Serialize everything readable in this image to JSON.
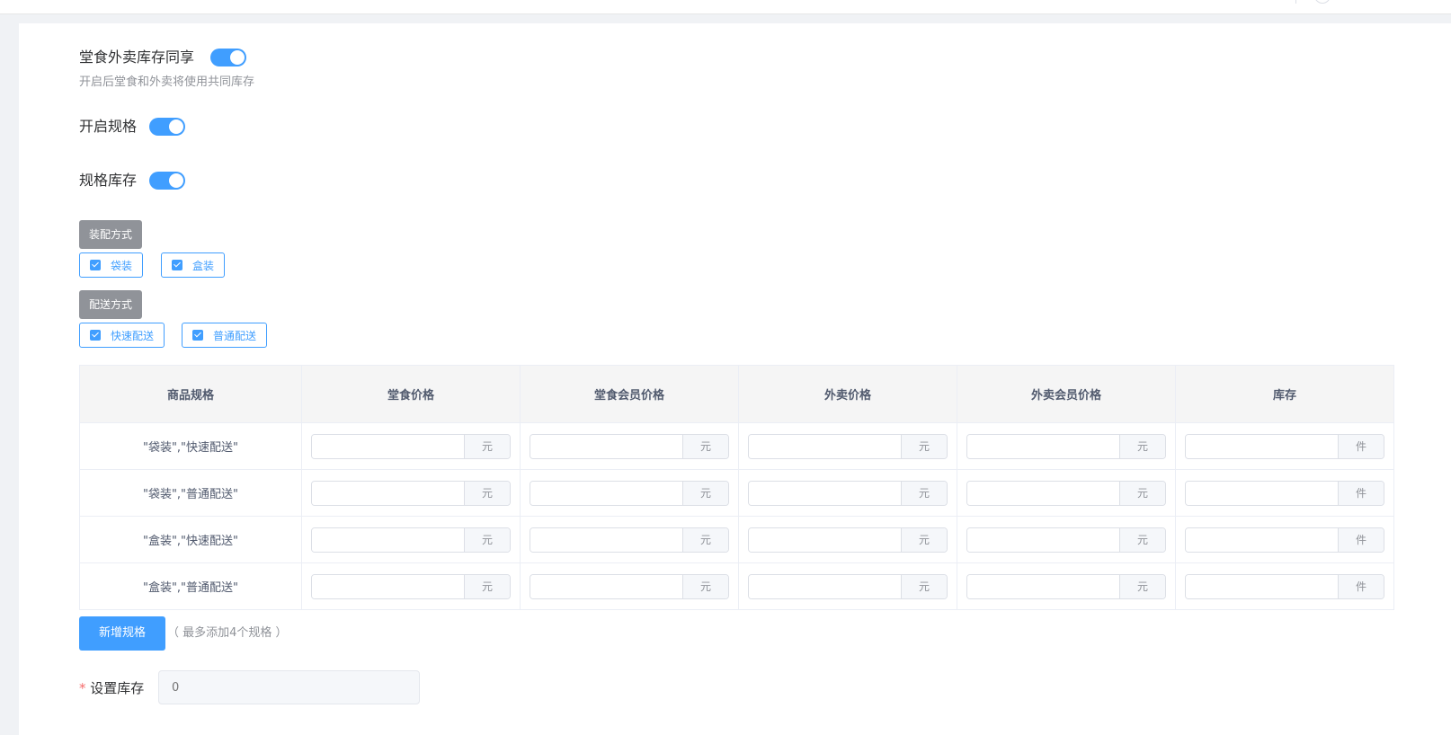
{
  "settings": {
    "shared_stock_label": "堂食外卖库存同享",
    "shared_stock_on": true,
    "shared_stock_hint": "开启后堂食和外卖将使用共同库存",
    "enable_spec_label": "开启规格",
    "enable_spec_on": true,
    "spec_stock_label": "规格库存",
    "spec_stock_on": true
  },
  "spec_groups": [
    {
      "name": "装配方式",
      "options": [
        {
          "label": "袋装",
          "checked": true
        },
        {
          "label": "盒装",
          "checked": true
        }
      ]
    },
    {
      "name": "配送方式",
      "options": [
        {
          "label": "快速配送",
          "checked": true
        },
        {
          "label": "普通配送",
          "checked": true
        }
      ]
    }
  ],
  "table": {
    "headers": [
      "商品规格",
      "堂食价格",
      "堂食会员价格",
      "外卖价格",
      "外卖会员价格",
      "库存"
    ],
    "rows": [
      {
        "spec": "\"袋装\",\"快速配送\""
      },
      {
        "spec": "\"袋装\",\"普通配送\""
      },
      {
        "spec": "\"盒装\",\"快速配送\""
      },
      {
        "spec": "\"盒装\",\"普通配送\""
      }
    ],
    "price_unit": "元",
    "stock_unit": "件"
  },
  "add_spec": {
    "button_label": "新增规格",
    "hint": "（ 最多添加4个规格 ）"
  },
  "stock_setting": {
    "required_mark": "*",
    "label": "设置库存",
    "placeholder": "0"
  },
  "colors": {
    "primary": "#409eff",
    "tag_gray": "#909399",
    "required": "#f56c6c"
  }
}
